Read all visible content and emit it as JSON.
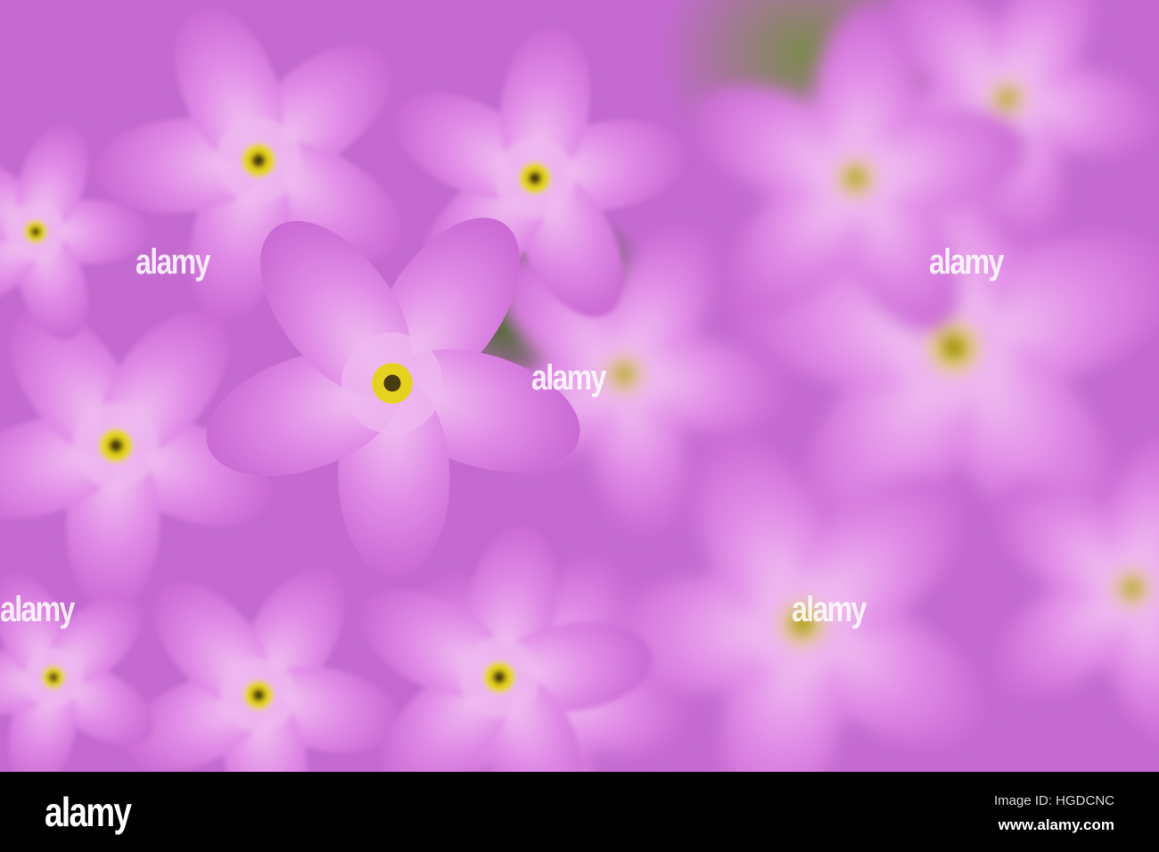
{
  "photo": {
    "subject": "pink primula flowers",
    "watermark_text": "alamy",
    "colors": {
      "petal": "#d77ee0",
      "petal_light": "#eeb6f0",
      "center": "#e6d21e",
      "leaf": "#5a7536"
    }
  },
  "footer": {
    "logo": "alamy",
    "image_id": "Image ID: HGDCNC",
    "url": "www.alamy.com"
  }
}
